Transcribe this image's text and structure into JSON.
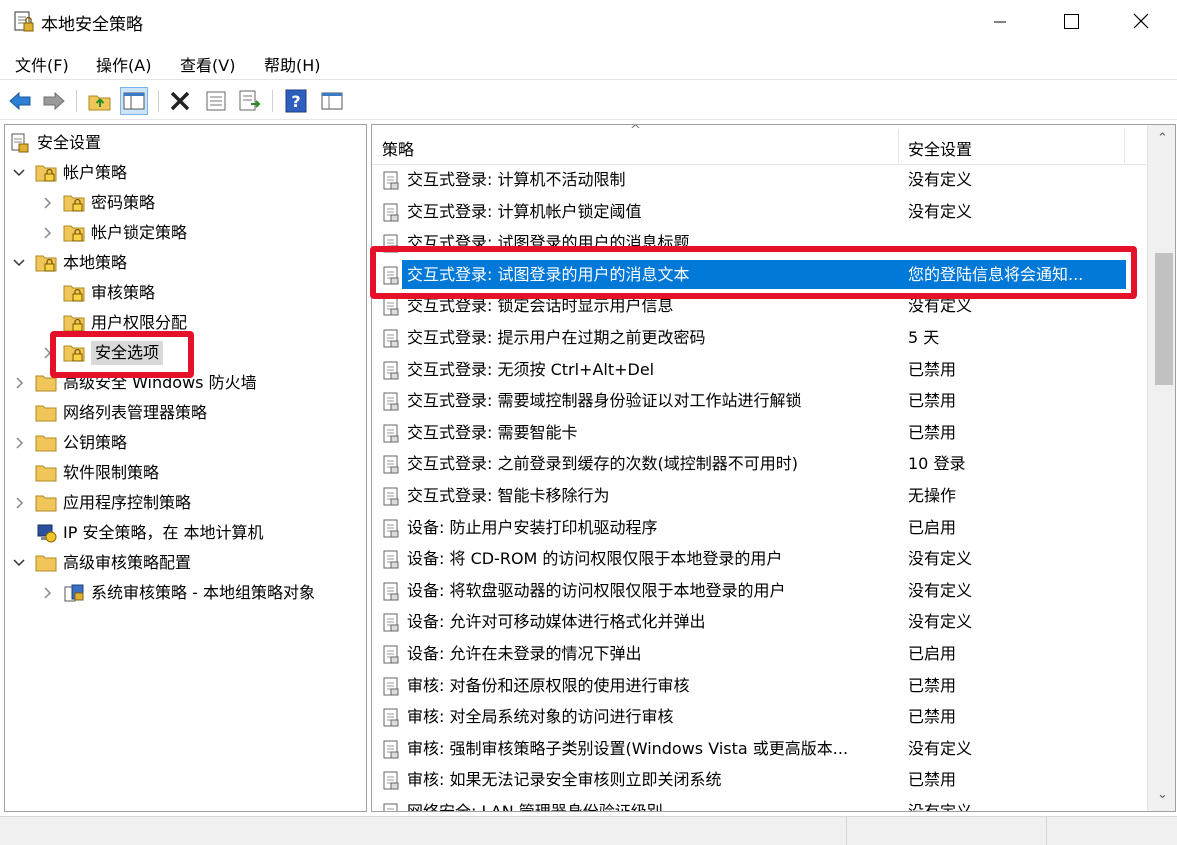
{
  "window": {
    "title": "本地安全策略",
    "minimize_label": "─",
    "maximize_label": "☐",
    "close_label": "✕"
  },
  "menu": [
    "文件(F)",
    "操作(A)",
    "查看(V)",
    "帮助(H)"
  ],
  "toolbar": {
    "buttons": [
      "back-icon",
      "forward-icon",
      "up-folder-icon",
      "show-hide-tree-icon",
      "delete-icon",
      "properties-icon",
      "export-list-icon",
      "help-icon",
      "view-icon"
    ]
  },
  "tree": [
    {
      "label": "安全设置",
      "level": 0,
      "expander": "",
      "icon": "security-settings-icon"
    },
    {
      "label": "帐户策略",
      "level": 1,
      "expander": "open",
      "icon": "policy-folder-icon"
    },
    {
      "label": "密码策略",
      "level": 2,
      "expander": "closed",
      "icon": "policy-folder-icon"
    },
    {
      "label": "帐户锁定策略",
      "level": 2,
      "expander": "closed",
      "icon": "policy-folder-icon"
    },
    {
      "label": "本地策略",
      "level": 1,
      "expander": "open",
      "icon": "policy-folder-icon"
    },
    {
      "label": "审核策略",
      "level": 2,
      "expander": "",
      "icon": "policy-folder-icon"
    },
    {
      "label": "用户权限分配",
      "level": 2,
      "expander": "",
      "icon": "policy-folder-icon"
    },
    {
      "label": "安全选项",
      "level": 2,
      "expander": "closed",
      "icon": "policy-folder-icon",
      "selected": true
    },
    {
      "label": "高级安全 Windows 防火墙",
      "level": 1,
      "expander": "closed",
      "icon": "folder-icon"
    },
    {
      "label": "网络列表管理器策略",
      "level": 1,
      "expander": "",
      "icon": "folder-icon"
    },
    {
      "label": "公钥策略",
      "level": 1,
      "expander": "closed",
      "icon": "folder-icon"
    },
    {
      "label": "软件限制策略",
      "level": 1,
      "expander": "",
      "icon": "folder-icon"
    },
    {
      "label": "应用程序控制策略",
      "level": 1,
      "expander": "closed",
      "icon": "folder-icon"
    },
    {
      "label": "IP 安全策略，在 本地计算机",
      "level": 1,
      "expander": "",
      "icon": "ip-security-icon"
    },
    {
      "label": "高级审核策略配置",
      "level": 1,
      "expander": "open",
      "icon": "folder-icon"
    },
    {
      "label": "系统审核策略 - 本地组策略对象",
      "level": 2,
      "expander": "closed",
      "icon": "audit-policy-icon"
    }
  ],
  "list": {
    "col_policy": "策略",
    "col_setting": "安全设置",
    "rows": [
      {
        "policy": "交互式登录: 计算机不活动限制",
        "setting": "没有定义"
      },
      {
        "policy": "交互式登录: 计算机帐户锁定阈值",
        "setting": "没有定义"
      },
      {
        "policy": "交互式登录: 试图登录的用户的消息标题",
        "setting": ""
      },
      {
        "policy": "交互式登录: 试图登录的用户的消息文本",
        "setting": "您的登陆信息将会通知...",
        "selected": true
      },
      {
        "policy": "交互式登录: 锁定会话时显示用户信息",
        "setting": "没有定义"
      },
      {
        "policy": "交互式登录: 提示用户在过期之前更改密码",
        "setting": "5 天"
      },
      {
        "policy": "交互式登录: 无须按 Ctrl+Alt+Del",
        "setting": "已禁用"
      },
      {
        "policy": "交互式登录: 需要域控制器身份验证以对工作站进行解锁",
        "setting": "已禁用"
      },
      {
        "policy": "交互式登录: 需要智能卡",
        "setting": "已禁用"
      },
      {
        "policy": "交互式登录: 之前登录到缓存的次数(域控制器不可用时)",
        "setting": "10 登录"
      },
      {
        "policy": "交互式登录: 智能卡移除行为",
        "setting": "无操作"
      },
      {
        "policy": "设备: 防止用户安装打印机驱动程序",
        "setting": "已启用"
      },
      {
        "policy": "设备: 将 CD-ROM 的访问权限仅限于本地登录的用户",
        "setting": "没有定义"
      },
      {
        "policy": "设备: 将软盘驱动器的访问权限仅限于本地登录的用户",
        "setting": "没有定义"
      },
      {
        "policy": "设备: 允许对可移动媒体进行格式化并弹出",
        "setting": "没有定义"
      },
      {
        "policy": "设备: 允许在未登录的情况下弹出",
        "setting": "已启用"
      },
      {
        "policy": "审核: 对备份和还原权限的使用进行审核",
        "setting": "已禁用"
      },
      {
        "policy": "审核: 对全局系统对象的访问进行审核",
        "setting": "已禁用"
      },
      {
        "policy": "审核: 强制审核策略子类别设置(Windows Vista 或更高版本...",
        "setting": "没有定义"
      },
      {
        "policy": "审核: 如果无法记录安全审核则立即关闭系统",
        "setting": "已禁用"
      },
      {
        "policy": "网络安全: LAN 管理器身份验证级别",
        "setting": "没有定义"
      }
    ]
  },
  "colors": {
    "selection": "#0078d7",
    "highlight_box": "#e5112a",
    "folder": "#f0c65a"
  }
}
